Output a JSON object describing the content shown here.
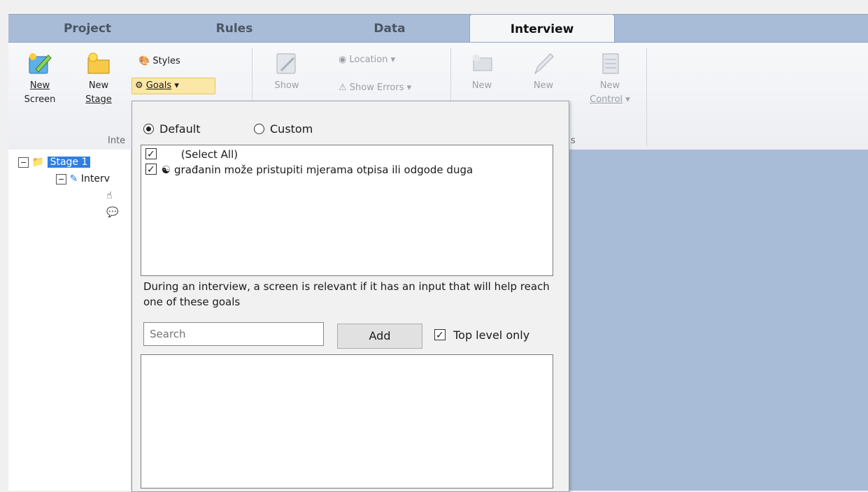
{
  "tabs": [
    {
      "label": "Project"
    },
    {
      "label": "Rules"
    },
    {
      "label": "Data"
    },
    {
      "label": "Interview"
    }
  ],
  "ribbon": {
    "new_screen": {
      "line1": "New",
      "line2": "Screen"
    },
    "new_stage": {
      "line1": "New",
      "line2": "Stage"
    },
    "styles": "Styles",
    "goals": "Goals",
    "show": "Show",
    "location": "Location",
    "show_errors": "Show Errors",
    "new_a": "New",
    "new_b": "New",
    "new_control": {
      "line1": "New",
      "line2": "Control"
    },
    "group_label_interview": "Inte",
    "group_label_controls": "s"
  },
  "tree": {
    "stage": "Stage 1",
    "interview": "Interv"
  },
  "goals_dropdown": {
    "radio_default": "Default",
    "radio_custom": "Custom",
    "selected_mode": "Default",
    "items": [
      {
        "label": "(Select All)",
        "checked": true
      },
      {
        "label": "građanin može pristupiti mjerama otpisa ili odgode duga",
        "checked": true
      }
    ],
    "description": "During an interview, a screen is relevant if it has an input that will help reach one of these goals",
    "search_placeholder": "Search",
    "add_label": "Add",
    "top_level_only": "Top level only",
    "top_level_checked": true
  },
  "colors": {
    "tabbar": "#a9bcd7",
    "selected_tree": "#2f7fe0",
    "goals_highlight": "#fbe7a6"
  }
}
